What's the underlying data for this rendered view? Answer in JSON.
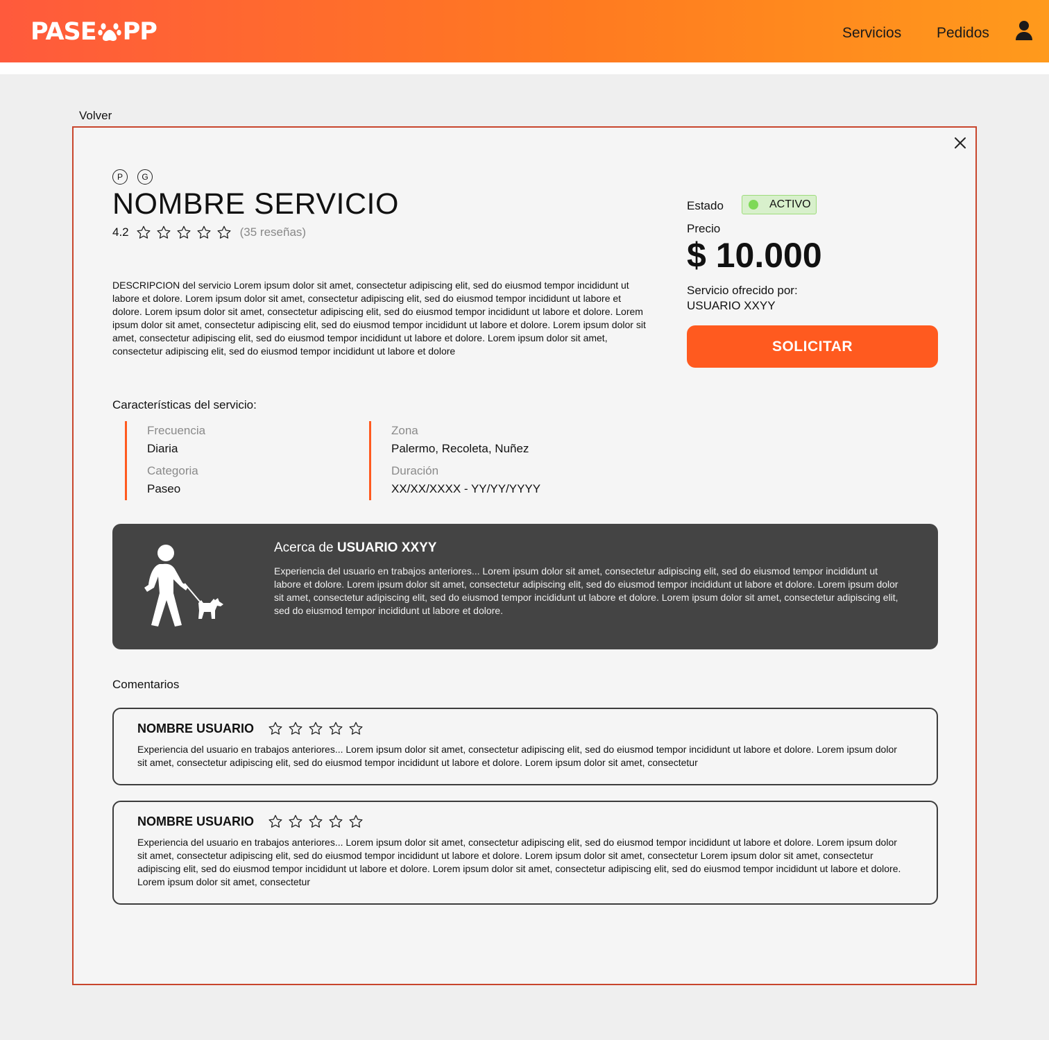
{
  "header": {
    "logo_left": "PASE",
    "logo_right": "PP",
    "nav": [
      "Servicios",
      "Pedidos"
    ]
  },
  "volver": "Volver",
  "service": {
    "badges": [
      "P",
      "G"
    ],
    "title": "NOMBRE SERVICIO",
    "rating": "4.2",
    "reviews": "(35 reseñas)",
    "description": "DESCRIPCION del servicio Lorem ipsum dolor sit amet, consectetur adipiscing elit, sed do eiusmod tempor incididunt ut labore et dolore.  Lorem ipsum dolor sit amet, consectetur adipiscing elit, sed do eiusmod tempor incididunt ut labore et dolore. Lorem ipsum dolor sit amet, consectetur adipiscing elit, sed do eiusmod tempor incididunt ut labore et dolore. Lorem ipsum dolor sit amet, consectetur adipiscing elit, sed do eiusmod tempor incididunt ut labore et dolore. Lorem ipsum dolor sit amet, consectetur adipiscing elit, sed do eiusmod tempor incididunt ut labore et dolore. Lorem ipsum dolor sit amet, consectetur adipiscing elit, sed do eiusmod tempor incididunt ut labore et dolore"
  },
  "side": {
    "estado_label": "Estado",
    "status": "ACTIVO",
    "status_color": "#7ed957",
    "precio_label": "Precio",
    "price": "$ 10.000",
    "offered_label": "Servicio ofrecido por:",
    "offered_by": "USUARIO XXYY",
    "button": "SOLICITAR",
    "button_color": "#ff5a1f"
  },
  "characteristics": {
    "title": "Características del servicio:",
    "col1": [
      {
        "label": "Frecuencia",
        "value": "Diaria"
      },
      {
        "label": "Categoria",
        "value": "Paseo"
      }
    ],
    "col2": [
      {
        "label": "Zona",
        "value": "Palermo, Recoleta, Nuñez"
      },
      {
        "label": "Duración",
        "value": "XX/XX/XXXX - YY/YY/YYYY"
      }
    ]
  },
  "about": {
    "prefix": "Acerca de",
    "user": "USUARIO XXYY",
    "text": "Experiencia del usuario en trabajos anteriores... Lorem ipsum dolor sit amet, consectetur adipiscing elit, sed do eiusmod tempor incididunt ut labore et dolore.  Lorem ipsum dolor sit amet, consectetur adipiscing elit, sed do eiusmod tempor incididunt ut labore et dolore. Lorem ipsum dolor sit amet, consectetur adipiscing elit, sed do eiusmod tempor incididunt ut labore et dolore. Lorem ipsum dolor sit amet, consectetur adipiscing elit, sed do eiusmod tempor incididunt ut labore et dolore."
  },
  "comments": {
    "title": "Comentarios",
    "items": [
      {
        "name": "NOMBRE USUARIO",
        "text": "Experiencia del usuario en trabajos anteriores... Lorem ipsum dolor sit amet, consectetur adipiscing elit, sed do eiusmod tempor incididunt ut labore et dolore.  Lorem ipsum dolor sit amet, consectetur adipiscing elit, sed do eiusmod tempor incididunt ut labore et dolore. Lorem ipsum dolor sit amet, consectetur"
      },
      {
        "name": "NOMBRE USUARIO",
        "text": "Experiencia del usuario en trabajos anteriores... Lorem ipsum dolor sit amet, consectetur adipiscing elit, sed do eiusmod tempor incididunt ut labore et dolore.  Lorem ipsum dolor sit amet, consectetur adipiscing elit, sed do eiusmod tempor incididunt ut labore et dolore. Lorem ipsum dolor sit amet, consectetur  Lorem ipsum dolor sit amet, consectetur adipiscing elit, sed do eiusmod tempor incididunt ut labore et dolore.  Lorem ipsum dolor sit amet, consectetur adipiscing elit, sed do eiusmod tempor incididunt ut labore et dolore. Lorem ipsum dolor sit amet, consectetur"
      }
    ]
  }
}
